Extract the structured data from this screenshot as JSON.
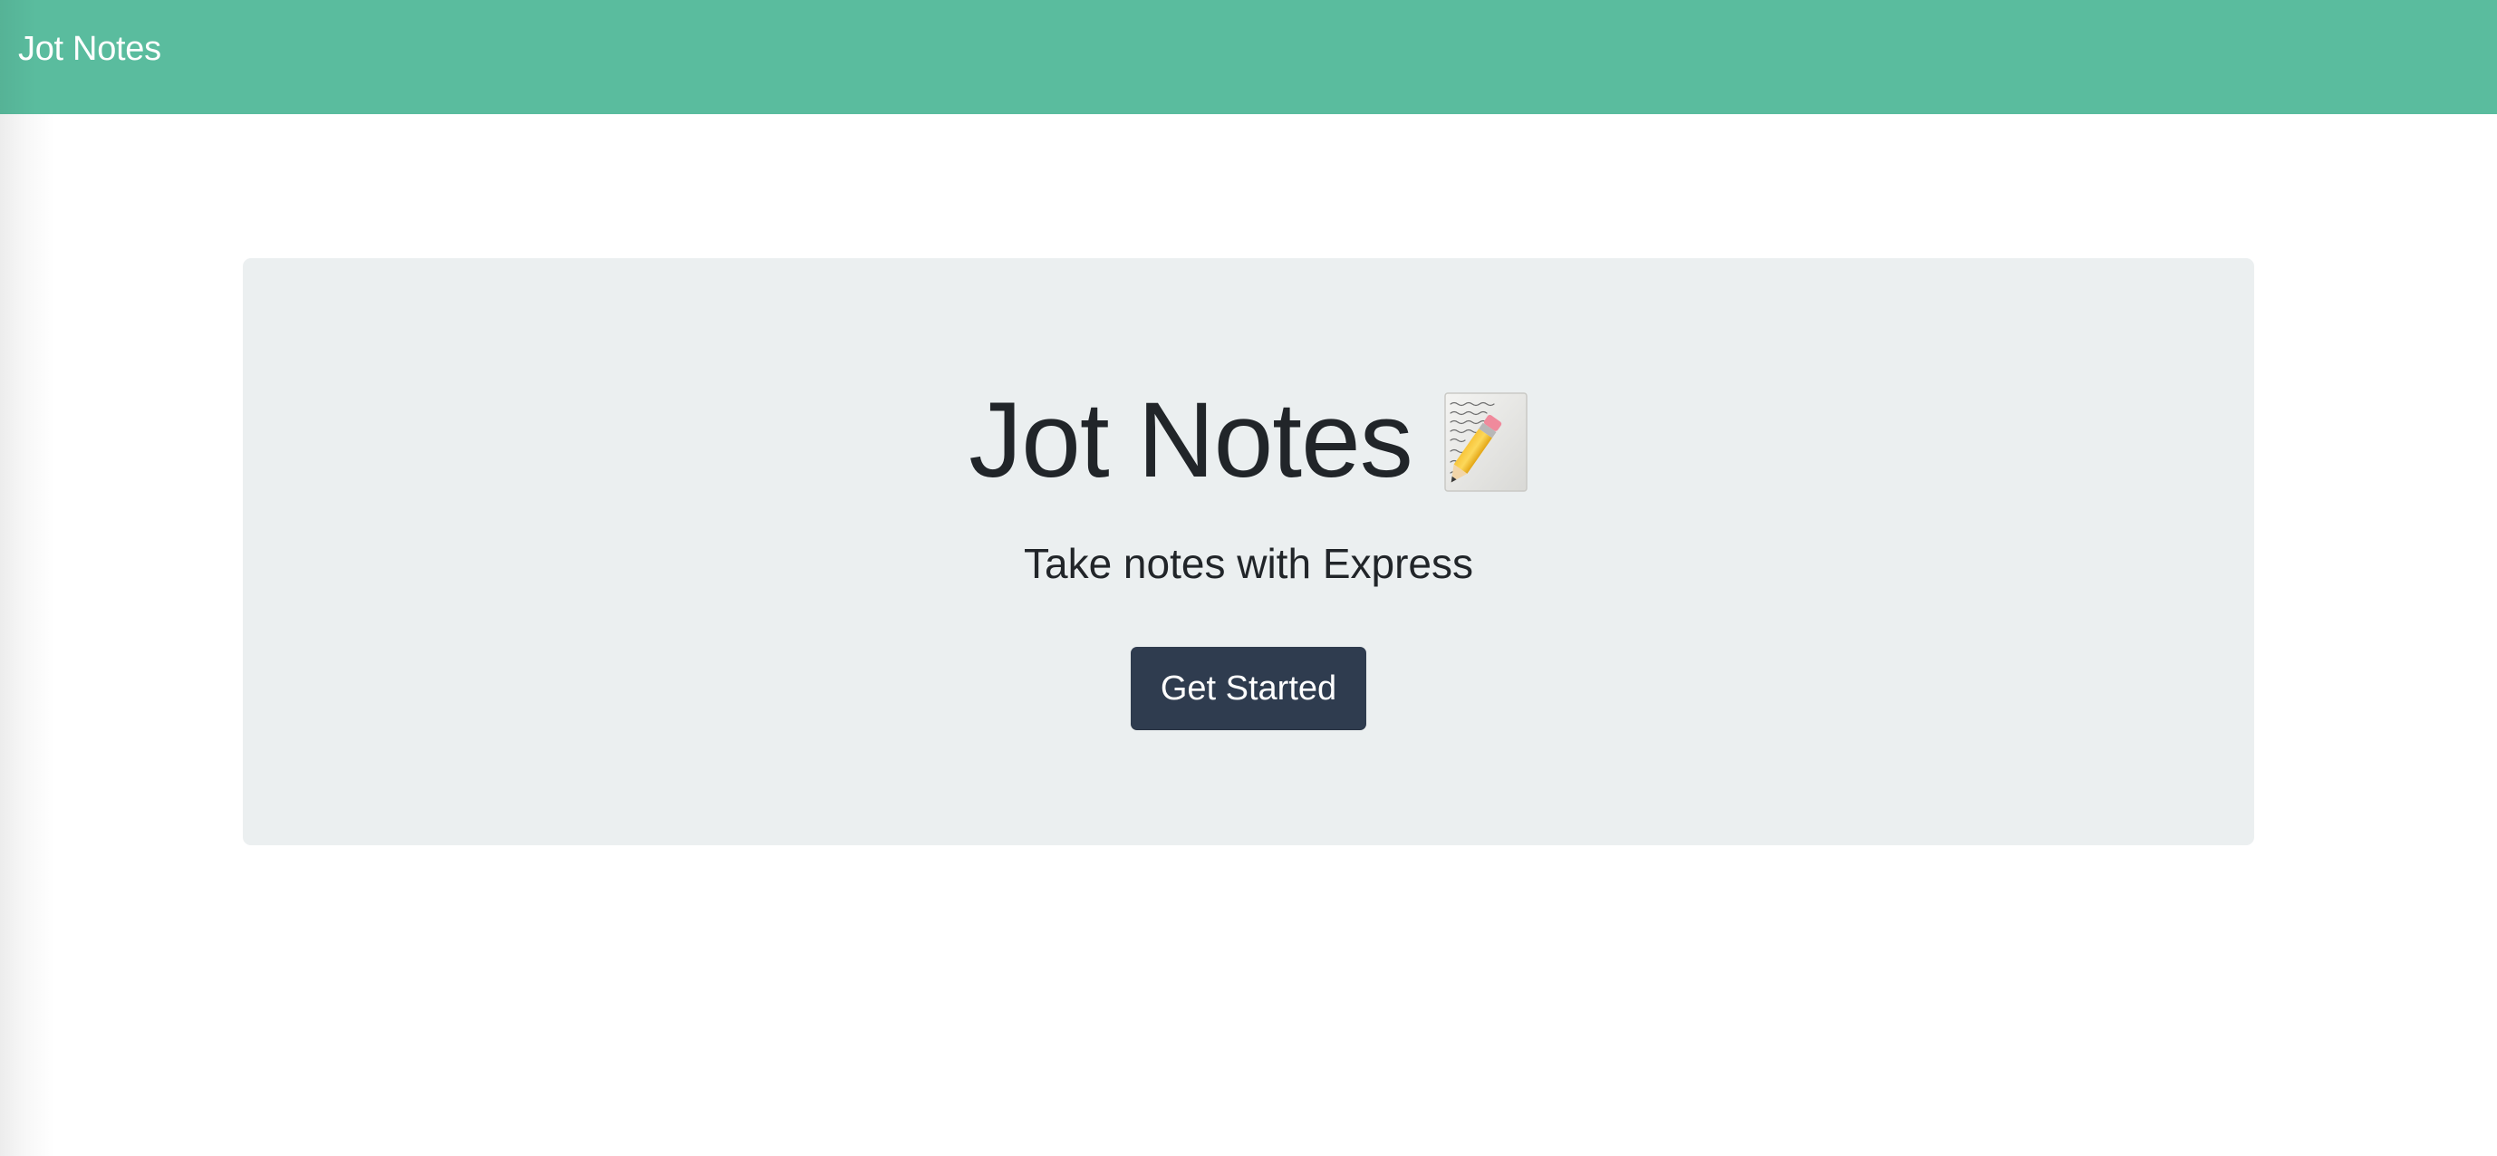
{
  "navbar": {
    "brand": "Jot Notes",
    "background_color": "#5abc9e"
  },
  "hero": {
    "title": "Jot Notes",
    "icon": "memo-icon",
    "subtitle": "Take notes with Express",
    "background_color": "#ebeff0"
  },
  "cta": {
    "label": "Get Started",
    "background_color": "#2f3c4f"
  }
}
